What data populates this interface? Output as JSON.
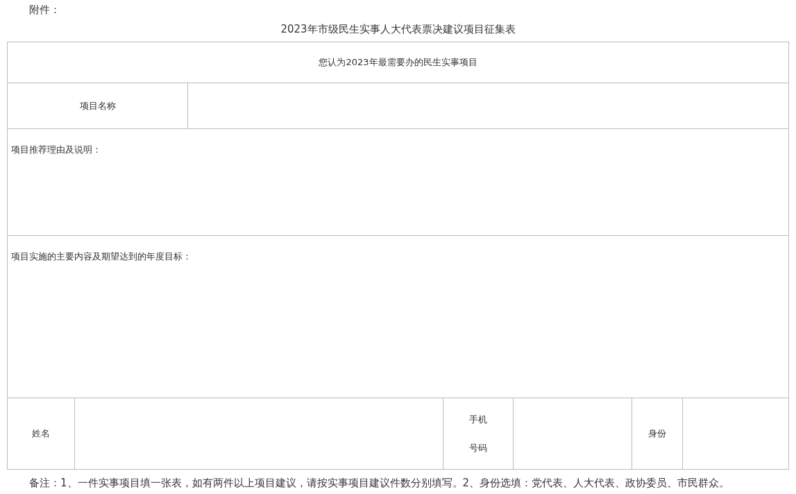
{
  "attachment_label": "附件：",
  "title": "2023年市级民生实事人大代表票决建议项目征集表",
  "form": {
    "header": "您认为2023年最需要办的民生实事项目",
    "project_name_label": "项目名称",
    "reason_label": "项目推荐理由及说明：",
    "content_label": "项目实施的主要内容及期望达到的年度目标：",
    "contact_labels": [
      "姓名",
      "手机号码",
      "身份"
    ]
  },
  "note": "备注：1、一件实事项目填一张表，如有两件以上项目建议，请按实事项目建议件数分别填写。2、身份选填：党代表、人大代表、政协委员、市民群众。"
}
